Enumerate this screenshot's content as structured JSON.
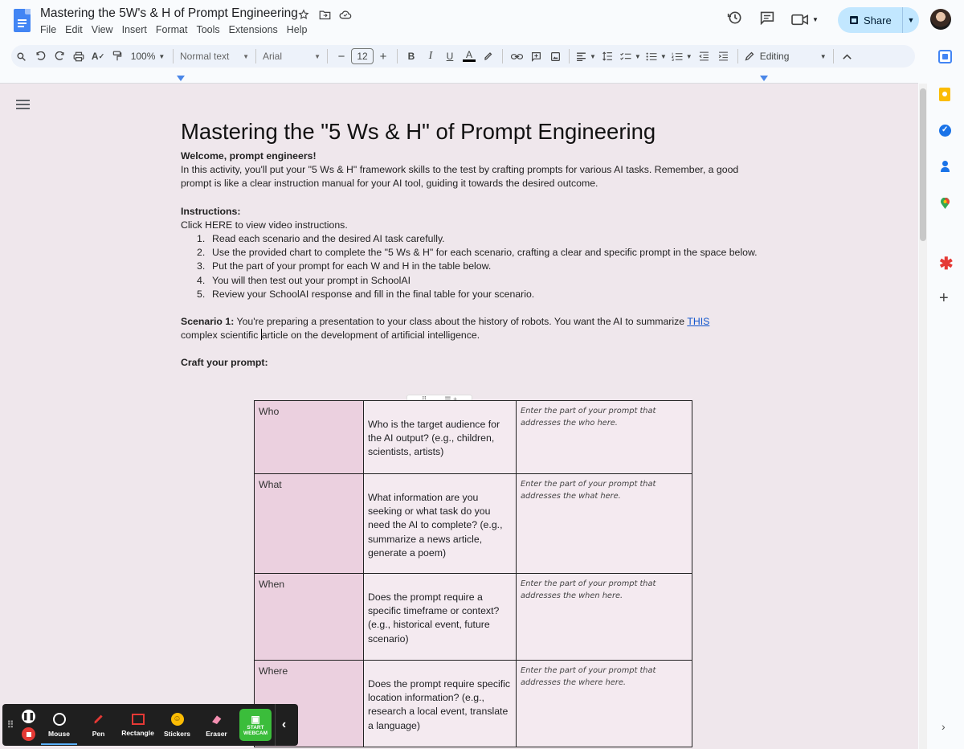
{
  "app": {
    "doc_title": "Mastering the 5W's & H of Prompt Engineering",
    "menu": [
      "File",
      "Edit",
      "View",
      "Insert",
      "Format",
      "Tools",
      "Extensions",
      "Help"
    ],
    "share_label": "Share"
  },
  "toolbar": {
    "zoom": "100%",
    "style": "Normal text",
    "font": "Arial",
    "font_size": "12",
    "mode": "Editing",
    "bold": "B",
    "italic": "I",
    "underline": "U",
    "text_color": "A"
  },
  "colors": {
    "accent": "#1a73e8",
    "share_bg": "#c2e7ff",
    "label_cell": "#ebd0df",
    "page_bg": "#efe7ec",
    "link": "#1155cc"
  },
  "document": {
    "heading": "Mastering the \"5 Ws & H\" of Prompt Engineering",
    "welcome": "Welcome, prompt engineers!",
    "intro": "In this activity, you'll put your \"5 Ws & H\" framework skills to the test by crafting prompts for various AI tasks. Remember, a good prompt is like a clear instruction manual for your AI tool, guiding it towards the desired outcome.",
    "instructions_heading": "Instructions:",
    "video_line": "Click HERE to view video instructions.",
    "steps": [
      {
        "n": "1.",
        "text": "Read each scenario and the desired AI task carefully."
      },
      {
        "n": "2.",
        "text": "Use the provided chart to complete the \"5 Ws & H\" for each scenario, crafting a clear and specific prompt in the space below."
      },
      {
        "n": "3.",
        "text": "Put the part of your prompt for each W and H in the table below."
      },
      {
        "n": "4.",
        "text": "You will then test out your prompt in SchoolAI"
      },
      {
        "n": "5.",
        "text": "Review your SchoolAI response and fill in the final table for your scenario."
      }
    ],
    "scenario_label": "Scenario 1:",
    "scenario_text_a": " You're preparing a presentation to your class about the history of robots. You want the AI to summarize ",
    "scenario_link": "THIS",
    "scenario_text_b1": "complex scientific ",
    "scenario_text_b2": "article on the development of artificial intelligence.",
    "craft_heading": "Craft your prompt:",
    "table": [
      {
        "label": "Who",
        "question": "Who is the target audience for the AI output? (e.g., children, scientists, artists)",
        "hint": "Enter the part of your prompt that addresses the who here."
      },
      {
        "label": "What",
        "question": "What information are you seeking or what task do you need the AI to complete? (e.g., summarize a news article, generate a poem)",
        "hint": "Enter the part of your prompt that addresses the what here."
      },
      {
        "label": "When",
        "question": "Does the prompt require a specific timeframe or context? (e.g., historical event, future scenario)",
        "hint": "Enter the part of your prompt that addresses the when here."
      },
      {
        "label": "Where",
        "question": "Does the prompt require specific location information? (e.g., research a local event, translate a language)",
        "hint": "Enter the part of your prompt that addresses the where here."
      }
    ]
  },
  "recorder": {
    "tools": [
      {
        "label": "Mouse",
        "icon": "mouse-icon"
      },
      {
        "label": "Pen",
        "icon": "pen-icon"
      },
      {
        "label": "Rectangle",
        "icon": "rectangle-icon"
      },
      {
        "label": "Stickers",
        "icon": "sticker-icon"
      },
      {
        "label": "Eraser",
        "icon": "eraser-icon"
      }
    ],
    "webcam_label_1": "START",
    "webcam_label_2": "WEBCAM"
  }
}
